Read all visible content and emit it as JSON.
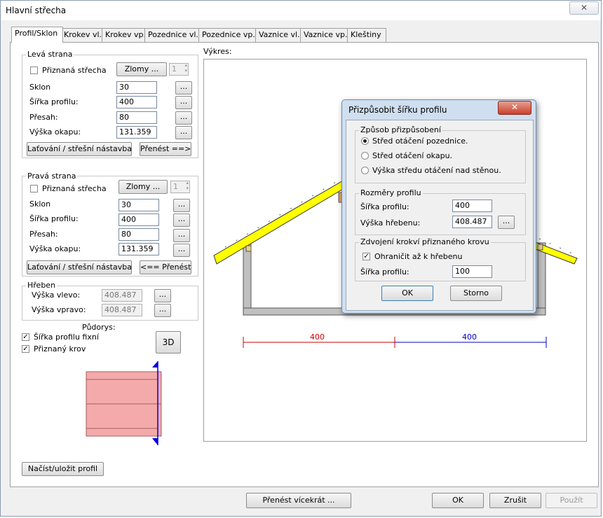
{
  "window": {
    "title": "Hlavní střecha",
    "close_glyph": "✕"
  },
  "tabs": [
    "Profil/Sklon",
    "Krokev vl.",
    "Krokev vp.",
    "Pozednice vl.",
    "Pozednice vp.",
    "Vaznice vl.",
    "Vaznice vp.",
    "Kleštiny"
  ],
  "left_side": {
    "title": "Levá strana",
    "visible_roof_label": "Přiznaná střecha",
    "breaks_button": "Zlomy ...",
    "breaks_count": "1",
    "slope_label": "Sklon",
    "slope_value": "30",
    "profile_width_label": "Šířka profilu:",
    "profile_width_value": "400",
    "overhang_label": "Přesah:",
    "overhang_value": "80",
    "eave_height_label": "Výška okapu:",
    "eave_height_value": "131.359",
    "batten_button": "Laťování / střešní nástavba",
    "transfer_button": "Přenést ==>"
  },
  "right_side": {
    "title": "Pravá strana",
    "visible_roof_label": "Přiznaná střecha",
    "breaks_button": "Zlomy ...",
    "breaks_count": "1",
    "slope_label": "Sklon",
    "slope_value": "30",
    "profile_width_label": "Šířka profilu:",
    "profile_width_value": "400",
    "overhang_label": "Přesah:",
    "overhang_value": "80",
    "eave_height_label": "Výška okapu:",
    "eave_height_value": "131.359",
    "batten_button": "Laťování / střešní nástavba",
    "transfer_button": "<== Přenést"
  },
  "ellipsis": "...",
  "ridge": {
    "title": "Hřeben",
    "left_height_label": "Výška vlevo:",
    "left_height_value": "408.487",
    "right_height_label": "Výška vpravo:",
    "right_height_value": "408.487"
  },
  "floor_plan": {
    "title": "Půdorys:",
    "fixed_width_label": "Šířka profilu fixní",
    "fixed_width_checked": true,
    "visible_truss_label": "Přiznaný krov",
    "visible_truss_checked": true,
    "button_3d": "3D",
    "fill_color": "#f4aaaa",
    "marker_color": "#0000e0"
  },
  "load_save_button": "Načíst/uložit profil",
  "drawing": {
    "label": "Výkres:",
    "dim_left": "400",
    "dim_right": "400",
    "dim_left_color": "#cc0000",
    "dim_right_color": "#0000cc",
    "roof_color": "#ffff00",
    "wall_color": "#c0c0c0"
  },
  "dialog": {
    "title": "Přizpůsobit šířku profilu",
    "close_glyph": "✕",
    "method_group": "Způsob přizpůsobení",
    "options": [
      "Střed otáčení pozednice.",
      "Střed otáčení okapu.",
      "Výška středu otáčení nad stěnou."
    ],
    "selected_option": 0,
    "dims_group": "Rozměry profilu",
    "width_label": "Šířka profilu:",
    "width_value": "400",
    "ridge_label": "Výška hřebenu:",
    "ridge_value": "408.487",
    "doubling_group": "Zdvojení krokví přiznaného krovu",
    "limit_label": "Ohraničit až k hřebenu",
    "limit_checked": true,
    "doubling_width_label": "Šířka profilu:",
    "doubling_width_value": "100",
    "ok": "OK",
    "cancel": "Storno"
  },
  "bottom": {
    "transfer_multi": "Přenést vícekrát ...",
    "ok": "OK",
    "cancel": "Zrušit",
    "apply": "Použít"
  }
}
